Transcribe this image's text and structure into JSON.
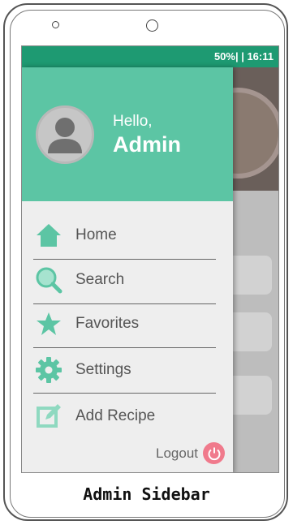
{
  "status_bar": {
    "text": "50%| | 16:11"
  },
  "drawer": {
    "greeting": "Hello,",
    "user_name": "Admin",
    "items": [
      {
        "label": "Home",
        "icon": "home-icon"
      },
      {
        "label": "Search",
        "icon": "search-icon"
      },
      {
        "label": "Favorites",
        "icon": "star-icon"
      },
      {
        "label": "Settings",
        "icon": "gear-icon"
      },
      {
        "label": "Add Recipe",
        "icon": "edit-icon"
      }
    ],
    "logout_label": "Logout"
  },
  "caption": "Admin Sidebar",
  "colors": {
    "header": "#5cc5a4",
    "status_bar": "#1e9a72",
    "icon": "#5cc5a4",
    "logout": "#f07a8c"
  }
}
